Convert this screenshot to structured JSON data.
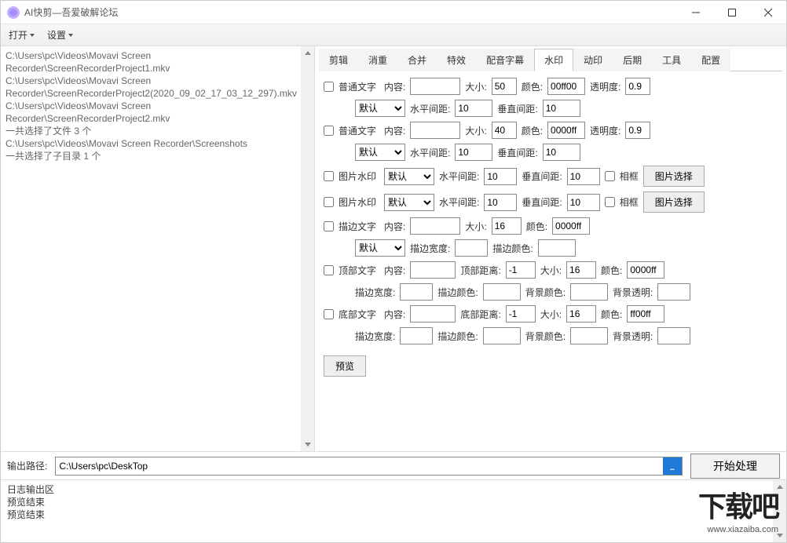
{
  "window": {
    "title": "AI快剪—吾爱破解论坛"
  },
  "menu": {
    "open": "打开",
    "settings": "设置"
  },
  "fileList": {
    "lines": [
      "C:\\Users\\pc\\Videos\\Movavi Screen Recorder\\ScreenRecorderProject1.mkv",
      "C:\\Users\\pc\\Videos\\Movavi Screen Recorder\\ScreenRecorderProject2(2020_09_02_17_03_12_297).mkv",
      "C:\\Users\\pc\\Videos\\Movavi Screen Recorder\\ScreenRecorderProject2.mkv",
      "一共选择了文件 3 个",
      "C:\\Users\\pc\\Videos\\Movavi Screen Recorder\\Screenshots",
      "一共选择了子目录 1 个"
    ]
  },
  "tabs": {
    "clip": "剪辑",
    "remove": "消重",
    "merge": "合并",
    "effects": "特效",
    "dub": "配音字幕",
    "watermark": "水印",
    "dyn": "动印",
    "post": "后期",
    "tools": "工具",
    "config": "配置"
  },
  "wm": {
    "text1": {
      "chk": "普通文字",
      "content": "内容:",
      "contentVal": "",
      "size": "大小:",
      "sizeVal": "50",
      "color": "颜色:",
      "colorVal": "00ff00",
      "opacity": "透明度:",
      "opacityVal": "0.9",
      "pos": "默认",
      "hgap": "水平间距:",
      "hgapVal": "10",
      "vgap": "垂直间距:",
      "vgapVal": "10"
    },
    "text2": {
      "chk": "普通文字",
      "content": "内容:",
      "contentVal": "",
      "size": "大小:",
      "sizeVal": "40",
      "color": "颜色:",
      "colorVal": "0000ff",
      "opacity": "透明度:",
      "opacityVal": "0.9",
      "pos": "默认",
      "hgap": "水平间距:",
      "hgapVal": "10",
      "vgap": "垂直间距:",
      "vgapVal": "10"
    },
    "img1": {
      "chk": "图片水印",
      "pos": "默认",
      "hgap": "水平间距:",
      "hgapVal": "10",
      "vgap": "垂直间距:",
      "vgapVal": "10",
      "frame": "相框",
      "btn": "图片选择"
    },
    "img2": {
      "chk": "图片水印",
      "pos": "默认",
      "hgap": "水平间距:",
      "hgapVal": "10",
      "vgap": "垂直间距:",
      "vgapVal": "10",
      "frame": "相框",
      "btn": "图片选择"
    },
    "outline": {
      "chk": "描边文字",
      "content": "内容:",
      "contentVal": "",
      "size": "大小:",
      "sizeVal": "16",
      "color": "颜色:",
      "colorVal": "0000ff",
      "pos": "默认",
      "bw": "描边宽度:",
      "bwVal": "",
      "bc": "描边颜色:",
      "bcVal": ""
    },
    "top": {
      "chk": "顶部文字",
      "content": "内容:",
      "contentVal": "",
      "dist": "顶部距离:",
      "distVal": "-1",
      "size": "大小:",
      "sizeVal": "16",
      "color": "颜色:",
      "colorVal": "0000ff",
      "bw": "描边宽度:",
      "bwVal": "",
      "bc": "描边颜色:",
      "bcVal": "",
      "bg": "背景颜色:",
      "bgVal": "",
      "bgo": "背景透明:",
      "bgoVal": ""
    },
    "bottom": {
      "chk": "底部文字",
      "content": "内容:",
      "contentVal": "",
      "dist": "底部距离:",
      "distVal": "-1",
      "size": "大小:",
      "sizeVal": "16",
      "color": "颜色:",
      "colorVal": "ff00ff",
      "bw": "描边宽度:",
      "bwVal": "",
      "bc": "描边颜色:",
      "bcVal": "",
      "bg": "背景颜色:",
      "bgVal": "",
      "bgo": "背景透明:",
      "bgoVal": ""
    },
    "previewBtn": "预览"
  },
  "output": {
    "label": "输出路径:",
    "path": "C:\\Users\\pc\\DeskTop",
    "startBtn": "开始处理"
  },
  "log": {
    "lines": "日志输出区\n预览结束\n预览结束"
  },
  "brand": {
    "big": "下载吧",
    "small": "www.xiazaiba.com"
  }
}
